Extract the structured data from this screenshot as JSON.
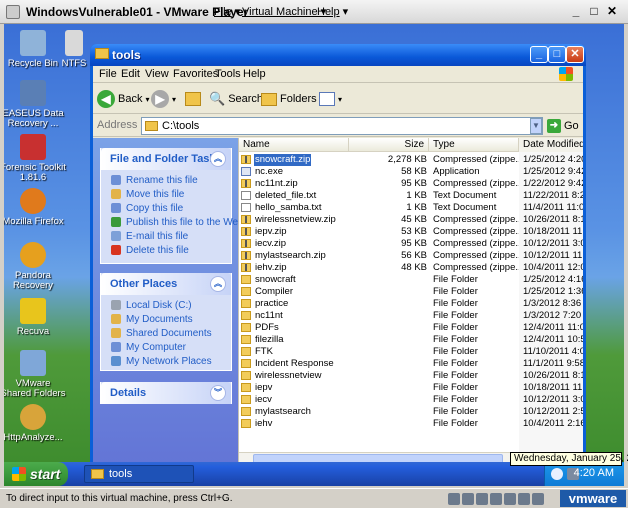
{
  "vmware": {
    "title": "WindowsVulnerable01 - VMware Player",
    "menu": [
      "File",
      "Virtual Machine",
      "Help"
    ],
    "status_message": "To direct input to this virtual machine, press Ctrl+G.",
    "brand": "vmware"
  },
  "desktop_icons": [
    {
      "label": "Recycle Bin",
      "color": "#8fb3d9"
    },
    {
      "label": "NTFS",
      "color": "#d9d9d9"
    },
    {
      "label": "EASEUS Data Recovery ...",
      "color": "#5a7fb5"
    },
    {
      "label": "Forensic Toolkit 1.81.6",
      "color": "#c83030"
    },
    {
      "label": "Mozilla Firefox",
      "color": "#e07a1c"
    },
    {
      "label": "Pandora Recovery",
      "color": "#e6a01e"
    },
    {
      "label": "Recuva",
      "color": "#e8c51c"
    },
    {
      "label": "VMware Shared Folders",
      "color": "#7fa7d8"
    },
    {
      "label": "HttpAnalyze...",
      "color": "#d8a43a"
    }
  ],
  "window": {
    "title": "tools",
    "menu": [
      "File",
      "Edit",
      "View",
      "Favorites",
      "Tools",
      "Help"
    ],
    "toolbar": {
      "back": "Back",
      "search": "Search",
      "folders": "Folders"
    },
    "address_label": "Address",
    "address": "C:\\tools",
    "go": "Go"
  },
  "tasks_panel": {
    "title": "File and Folder Tasks",
    "items": [
      {
        "label": "Rename this file",
        "color": "#6d8fd6"
      },
      {
        "label": "Move this file",
        "color": "#e2b34a"
      },
      {
        "label": "Copy this file",
        "color": "#6d8fd6"
      },
      {
        "label": "Publish this file to the Web",
        "color": "#3a9a3a"
      },
      {
        "label": "E-mail this file",
        "color": "#7da0d8"
      },
      {
        "label": "Delete this file",
        "color": "#d8331f"
      }
    ]
  },
  "places_panel": {
    "title": "Other Places",
    "items": [
      {
        "label": "Local Disk (C:)",
        "color": "#9aa3b0"
      },
      {
        "label": "My Documents",
        "color": "#e2b34a"
      },
      {
        "label": "Shared Documents",
        "color": "#e2b34a"
      },
      {
        "label": "My Computer",
        "color": "#6d8fd6"
      },
      {
        "label": "My Network Places",
        "color": "#5a8fd0"
      }
    ]
  },
  "details_panel": {
    "title": "Details"
  },
  "columns": [
    "Name",
    "Size",
    "Type",
    "Date Modified"
  ],
  "files": [
    {
      "name": "snowcraft.zip",
      "size": "2,278 KB",
      "type": "Compressed (zippe...",
      "date": "1/25/2012 4:20 A",
      "icon": "zip",
      "selected": true
    },
    {
      "name": "nc.exe",
      "size": "58 KB",
      "type": "Application",
      "date": "1/25/2012 9:42 AM",
      "icon": "exe"
    },
    {
      "name": "nc11nt.zip",
      "size": "95 KB",
      "type": "Compressed (zippe...",
      "date": "1/22/2012 9:42 AM",
      "icon": "zip"
    },
    {
      "name": "deleted_file.txt",
      "size": "1 KB",
      "type": "Text Document",
      "date": "11/22/2011 8:29 F",
      "icon": "txt"
    },
    {
      "name": "hello_samba.txt",
      "size": "1 KB",
      "type": "Text Document",
      "date": "11/4/2011 11:01 A",
      "icon": "txt"
    },
    {
      "name": "wirelessnetview.zip",
      "size": "45 KB",
      "type": "Compressed (zippe...",
      "date": "10/26/2011 8:15 F",
      "icon": "zip"
    },
    {
      "name": "iepv.zip",
      "size": "53 KB",
      "type": "Compressed (zippe...",
      "date": "10/18/2011 11:47",
      "icon": "zip"
    },
    {
      "name": "iecv.zip",
      "size": "95 KB",
      "type": "Compressed (zippe...",
      "date": "10/12/2011 3:02 F",
      "icon": "zip"
    },
    {
      "name": "mylastsearch.zip",
      "size": "56 KB",
      "type": "Compressed (zippe...",
      "date": "10/12/2011 11:25",
      "icon": "zip"
    },
    {
      "name": "iehv.zip",
      "size": "48 KB",
      "type": "Compressed (zippe...",
      "date": "10/4/2011 12:08 F",
      "icon": "zip"
    },
    {
      "name": "snowcraft",
      "size": "",
      "type": "File Folder",
      "date": "1/25/2012 4:16 AI",
      "icon": "folder"
    },
    {
      "name": "Compiler",
      "size": "",
      "type": "File Folder",
      "date": "1/25/2012 1:36 AI",
      "icon": "folder"
    },
    {
      "name": "practice",
      "size": "",
      "type": "File Folder",
      "date": "1/3/2012 8:36 PM",
      "icon": "folder"
    },
    {
      "name": "nc11nt",
      "size": "",
      "type": "File Folder",
      "date": "1/3/2012 7:20 PM",
      "icon": "folder"
    },
    {
      "name": "PDFs",
      "size": "",
      "type": "File Folder",
      "date": "12/4/2011 11:02 A",
      "icon": "folder"
    },
    {
      "name": "filezilla",
      "size": "",
      "type": "File Folder",
      "date": "12/4/2011 10:54 A",
      "icon": "folder"
    },
    {
      "name": "FTK",
      "size": "",
      "type": "File Folder",
      "date": "11/10/2011 4:09 F",
      "icon": "folder"
    },
    {
      "name": "Incident Response",
      "size": "",
      "type": "File Folder",
      "date": "11/1/2011 9:58 A",
      "icon": "folder"
    },
    {
      "name": "wirelessnetview",
      "size": "",
      "type": "File Folder",
      "date": "10/26/2011 8:19 F",
      "icon": "folder"
    },
    {
      "name": "iepv",
      "size": "",
      "type": "File Folder",
      "date": "10/18/2011 11:54",
      "icon": "folder"
    },
    {
      "name": "iecv",
      "size": "",
      "type": "File Folder",
      "date": "10/12/2011 3:08 F",
      "icon": "folder"
    },
    {
      "name": "mylastsearch",
      "size": "",
      "type": "File Folder",
      "date": "10/12/2011 2:57 F",
      "icon": "folder"
    },
    {
      "name": "iehv",
      "size": "",
      "type": "File Folder",
      "date": "10/4/2011 2:16 PI",
      "icon": "folder"
    }
  ],
  "taskbar": {
    "start": "start",
    "task_label": "tools",
    "time": "4:20 AM",
    "tooltip": "Wednesday, January 25, 2012"
  }
}
